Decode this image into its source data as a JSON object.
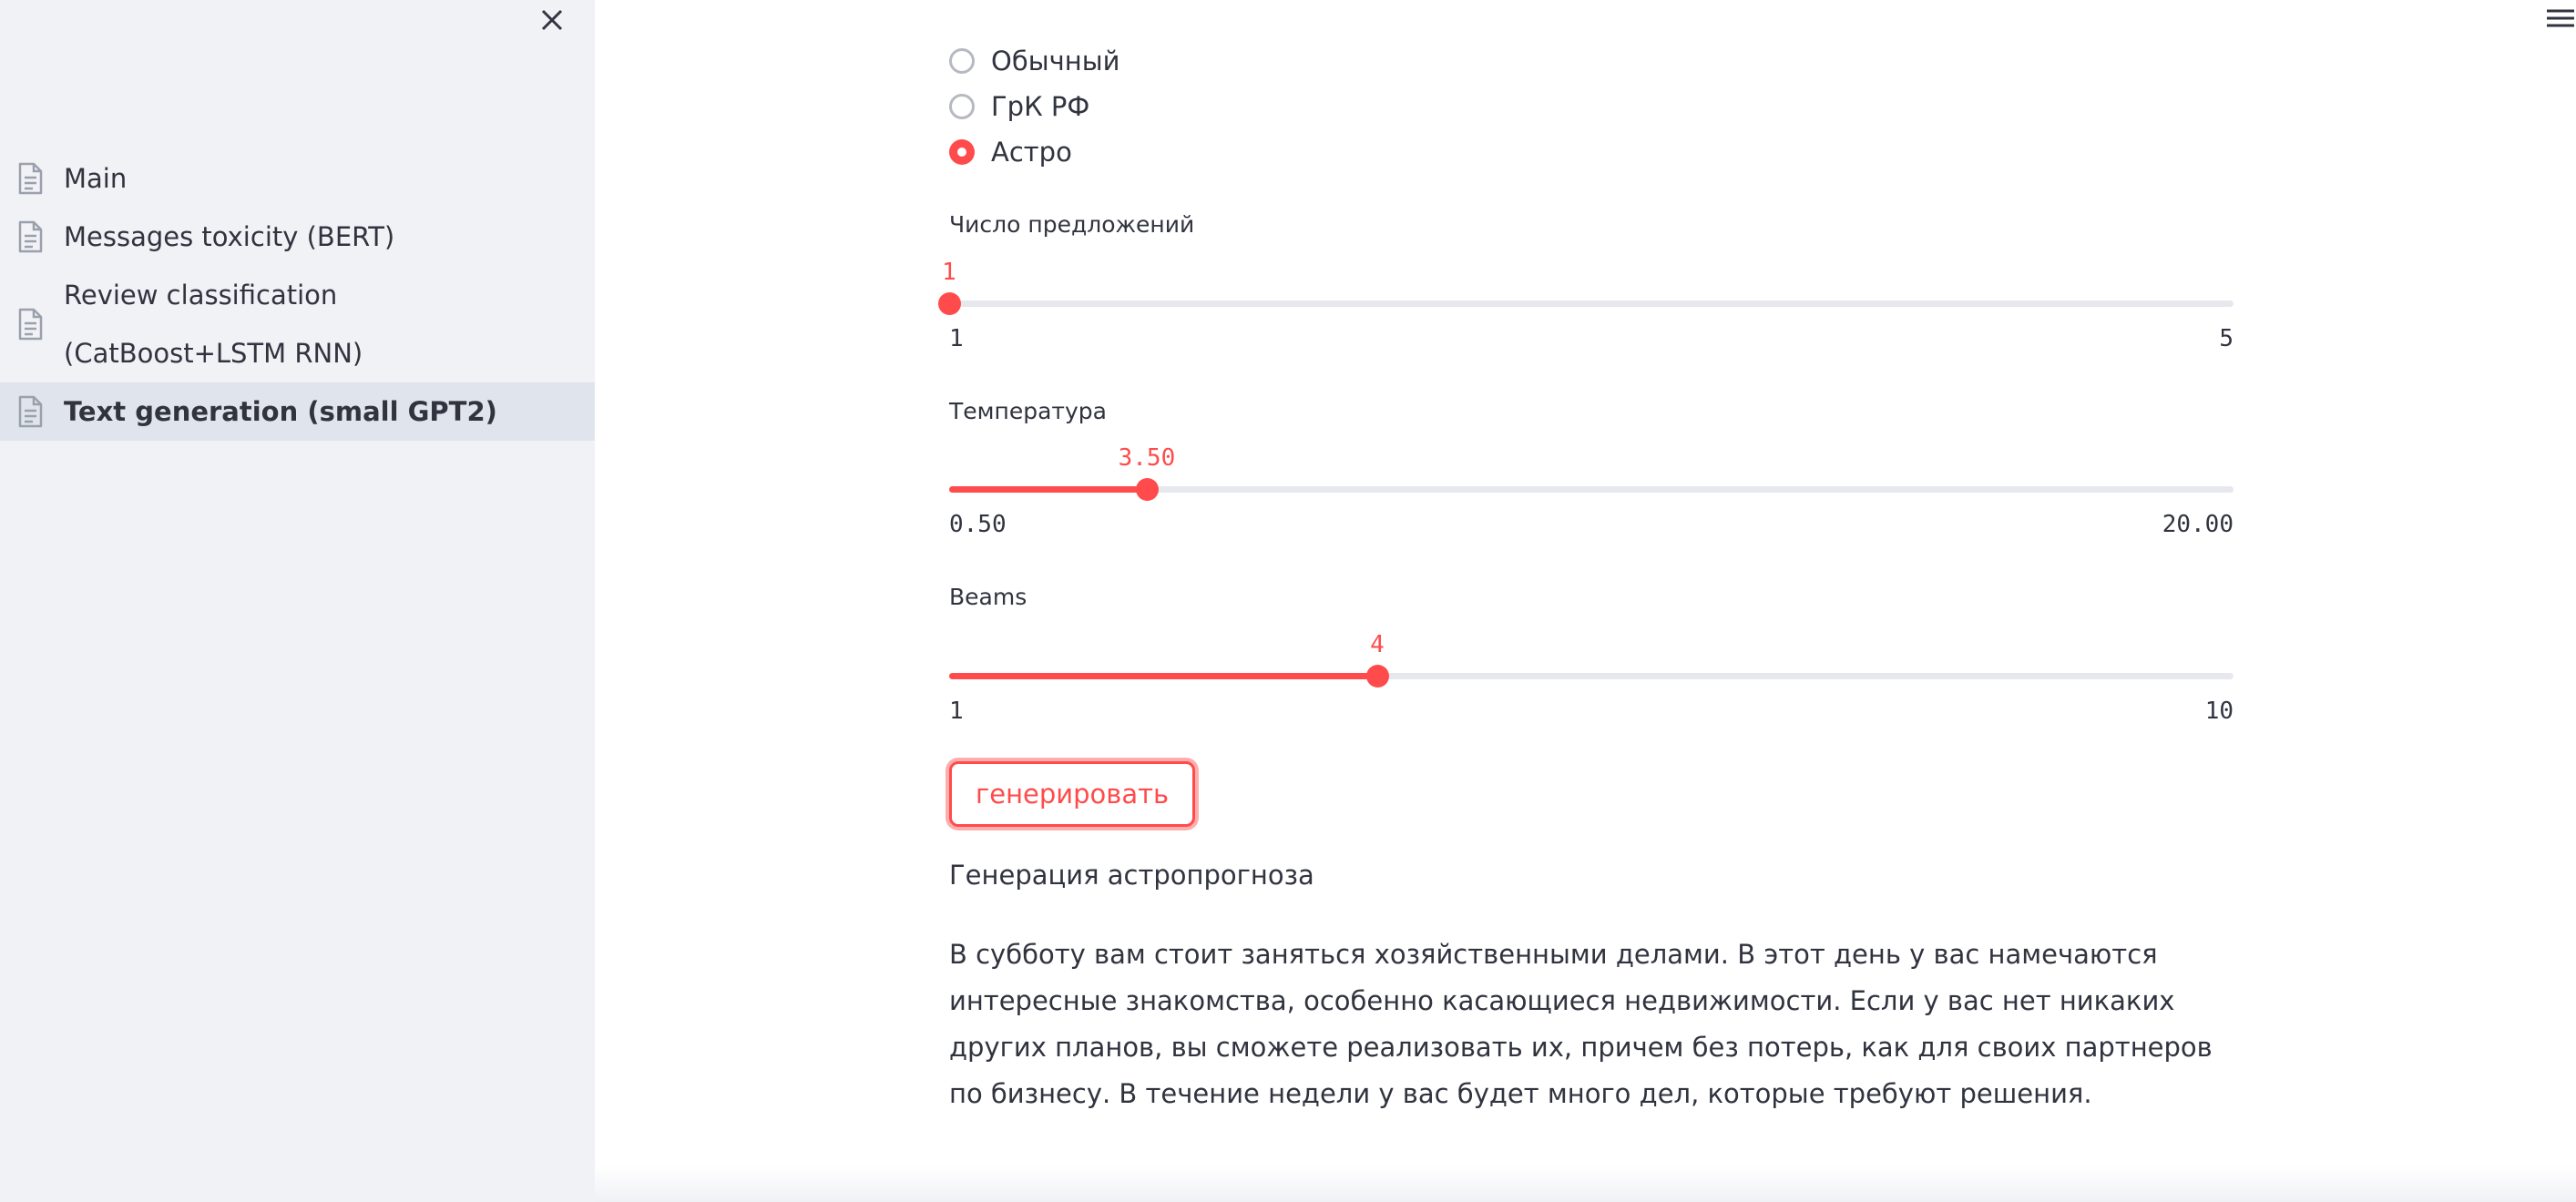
{
  "sidebar": {
    "items": [
      {
        "label": "Main",
        "active": false
      },
      {
        "label": "Messages toxicity (BERT)",
        "active": false
      },
      {
        "label": "Review classification (CatBoost+LSTM RNN)",
        "active": false
      },
      {
        "label": "Text generation (small GPT2)",
        "active": true
      }
    ]
  },
  "radio": {
    "options": [
      {
        "label": "Обычный",
        "checked": false
      },
      {
        "label": "ГрК РФ",
        "checked": false
      },
      {
        "label": "Астро",
        "checked": true
      }
    ]
  },
  "sliders": {
    "sentences": {
      "label": "Число предложений",
      "value": 1,
      "display": "1",
      "min": 1,
      "max": 5,
      "min_label": "1",
      "max_label": "5"
    },
    "temperature": {
      "label": "Температура",
      "value": 3.5,
      "display": "3.50",
      "min": 0.5,
      "max": 20.0,
      "min_label": "0.50",
      "max_label": "20.00"
    },
    "beams": {
      "label": "Beams",
      "value": 4,
      "display": "4",
      "min": 1,
      "max": 10,
      "min_label": "1",
      "max_label": "10"
    }
  },
  "generate_button": "генерировать",
  "section_title": "Генерация астропрогноза",
  "generated_text": "В субботу вам стоит заняться хозяйственными делами. В этот день у вас намечаются интересные знакомства, особенно касающиеся недвижимости. Если у вас нет никаких других планов, вы сможете реализовать их, причем без потерь, как для своих партнеров по бизнесу. В течение недели у вас будет много дел, которые требуют решения.",
  "colors": {
    "accent": "#ff4b4b",
    "sidebar_bg": "#f0f2f6",
    "active_item_bg": "#e0e5ed",
    "text": "#31333f"
  },
  "icons": {
    "close": "close-icon",
    "menu": "hamburger-menu-icon",
    "page": "document-icon"
  }
}
